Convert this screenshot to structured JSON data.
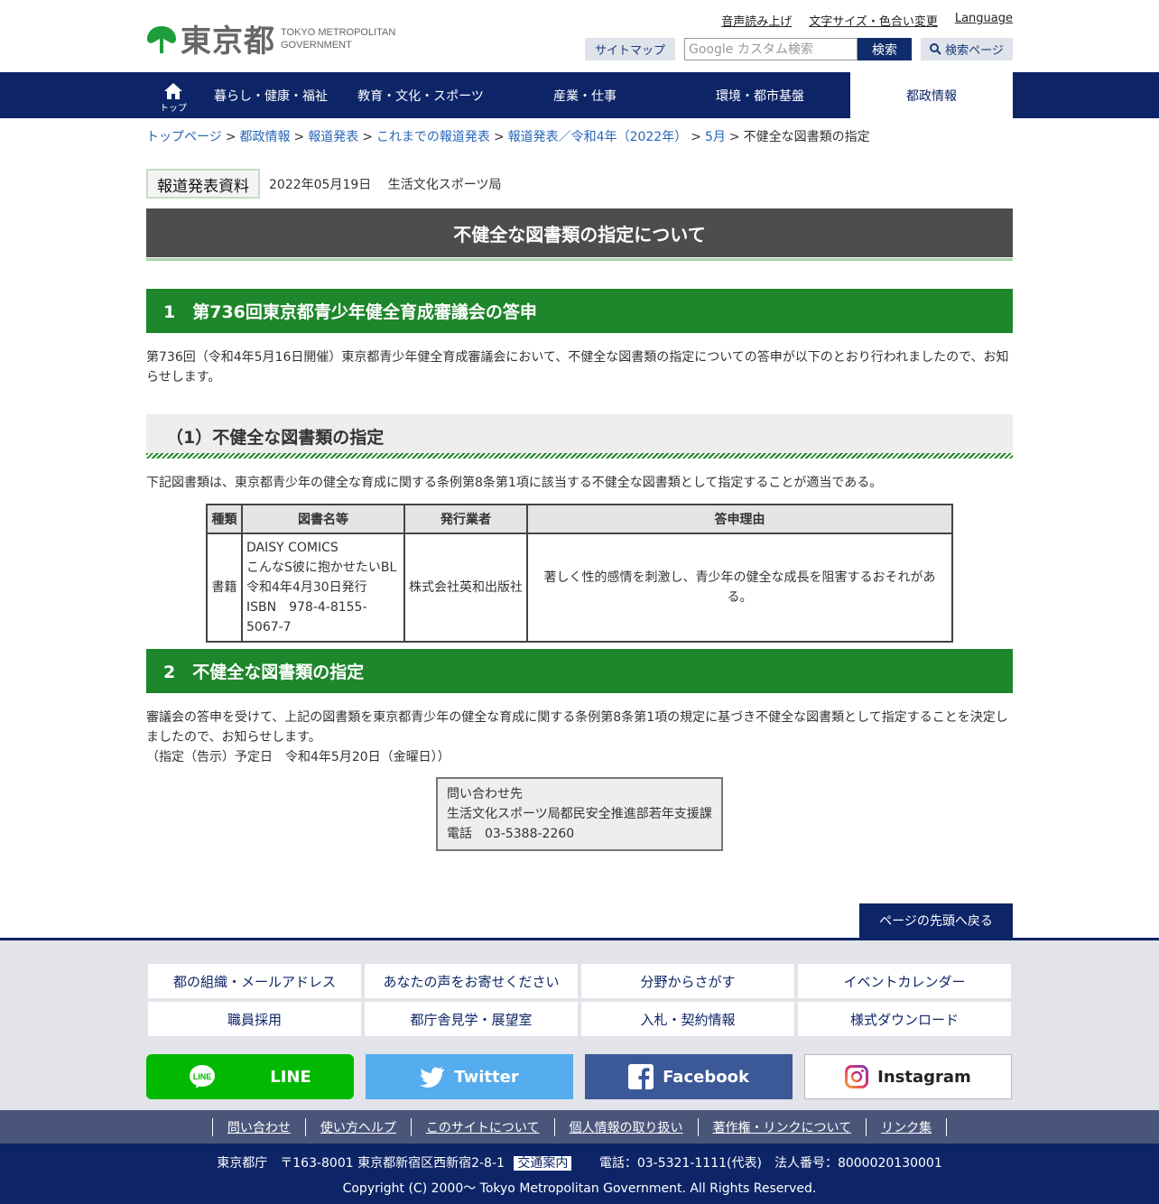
{
  "header": {
    "logo_jp": "東京都",
    "logo_en_1": "TOKYO METROPOLITAN",
    "logo_en_2": "GOVERNMENT",
    "util_links": [
      "音声読み上げ",
      "文字サイズ・色合い変更",
      "Language"
    ],
    "sitemap": "サイトマップ",
    "search_placeholder": "Google カスタム検索",
    "search_button": "検索",
    "search_page": "検索ページ"
  },
  "nav": {
    "home": "トップ",
    "items": [
      "暮らし・健康・福祉",
      "教育・文化・スポーツ",
      "産業・仕事",
      "環境・都市基盤",
      "都政情報"
    ]
  },
  "breadcrumb": {
    "links": [
      "トップページ",
      "都政情報",
      "報道発表",
      "これまでの報道発表",
      "報道発表／令和4年（2022年）",
      "5月"
    ],
    "current": "不健全な図書類の指定"
  },
  "press": {
    "badge": "報道発表資料",
    "date": "2022年05月19日",
    "bureau": "生活文化スポーツ局"
  },
  "title": "不健全な図書類の指定について",
  "section1": {
    "heading": "1　第736回東京都青少年健全育成審議会の答申",
    "text": "第736回（令和4年5月16日開催）東京都青少年健全育成審議会において、不健全な図書類の指定についての答申が以下のとおり行われましたので、お知らせします。",
    "sub_heading": "（1）不健全な図書類の指定",
    "sub_text": "下記図書類は、東京都青少年の健全な育成に関する条例第8条第1項に該当する不健全な図書類として指定することが適当である。"
  },
  "table": {
    "headers": [
      "種類",
      "図書名等",
      "発行業者",
      "答申理由"
    ],
    "row": {
      "type": "書籍",
      "title_1": "DAISY COMICS",
      "title_2": "こんなS彼に抱かせたいBL",
      "title_3": "令和4年4月30日発行",
      "title_4": "ISBN　978-4-8155-5067-7",
      "publisher": "株式会社英和出版社",
      "reason": "著しく性的感情を刺激し、青少年の健全な成長を阻害するおそれがある。"
    }
  },
  "section2": {
    "heading": "2　不健全な図書類の指定",
    "text": "審議会の答申を受けて、上記の図書類を東京都青少年の健全な育成に関する条例第8条第1項の規定に基づき不健全な図書類として指定することを決定しましたので、お知らせします。",
    "date_line": "（指定（告示）予定日　令和4年5月20日（金曜日））"
  },
  "contact": {
    "label": "問い合わせ先",
    "dept": "生活文化スポーツ局都民安全推進部若年支援課",
    "tel": "電話　03-5388-2260"
  },
  "back_to_top": "ページの先頭へ戻る",
  "footer": {
    "grid": [
      "都の組織・メールアドレス",
      "あなたの声をお寄せください",
      "分野からさがす",
      "イベントカレンダー",
      "職員採用",
      "都庁舎見学・展望室",
      "入札・契約情報",
      "様式ダウンロード"
    ],
    "sns": [
      "LINE",
      "Twitter",
      "Facebook",
      "Instagram"
    ],
    "bar_links": [
      "問い合わせ",
      "使い方ヘルプ",
      "このサイトについて",
      "個人情報の取り扱い",
      "著作権・リンクについて",
      "リンク集"
    ],
    "address": "東京都庁　〒163-8001 東京都新宿区西新宿2-8-1",
    "traffic": "交通案内",
    "phone": "電話：03-5321-1111(代表)　法人番号：8000020130001",
    "copyright": "Copyright (C) 2000～ Tokyo Metropolitan Government. All Rights Reserved."
  },
  "colors": {
    "navy": "#0d2567",
    "green": "#1e862b",
    "title_gray": "#4d4d4d"
  }
}
